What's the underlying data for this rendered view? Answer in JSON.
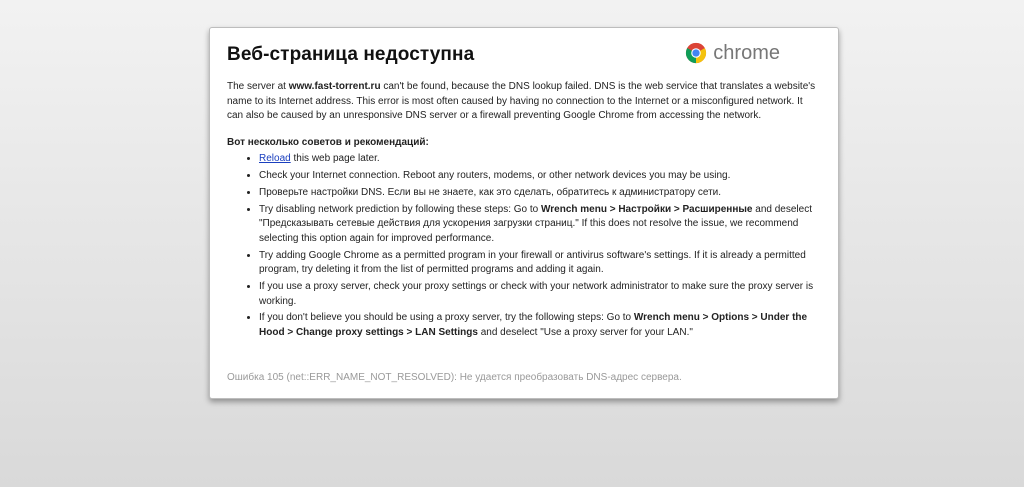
{
  "page": {
    "title": "Веб-страница недоступна",
    "brand": "chrome"
  },
  "intro": {
    "t1": "The server at ",
    "host": "www.fast-torrent.ru",
    "t2": " can't be found, because the DNS lookup failed. DNS is the web service that translates a website's name to its Internet address. This error is most often caused by having no connection to the Internet or a misconfigured network. It can also be caused by an unresponsive DNS server or a firewall preventing Google Chrome from accessing the network."
  },
  "tips": {
    "heading": "Вот несколько советов и рекомендаций:",
    "reload_link": "Reload",
    "reload_rest": " this web page later.",
    "check_connection": "Check your Internet connection. Reboot any routers, modems, or other network devices you may be using.",
    "dns_settings": "Проверьте настройки DNS. Если вы не знаете, как это сделать, обратитесь к администратору сети.",
    "prediction_a": "Try disabling network prediction by following these steps: Go to ",
    "prediction_path": "Wrench menu > Настройки > Расширенные",
    "prediction_b": " and deselect \"Предсказывать сетевые действия для ускорения загрузки страниц.\" If this does not resolve the issue, we recommend selecting this option again for improved performance.",
    "firewall": "Try adding Google Chrome as a permitted program in your firewall or antivirus software's settings. If it is already a permitted program, try deleting it from the list of permitted programs and adding it again.",
    "proxy_check": "If you use a proxy server, check your proxy settings or check with your network administrator to make sure the proxy server is working.",
    "proxy_a": "If you don't believe you should be using a proxy server, try the following steps: Go to ",
    "proxy_path": "Wrench menu > Options > Under the Hood > Change proxy settings > LAN Settings",
    "proxy_b": " and deselect \"Use a proxy server for your LAN.\""
  },
  "error": {
    "code": "Ошибка 105 (net::ERR_NAME_NOT_RESOLVED): Не удается преобразовать DNS-адрес сервера."
  },
  "colors": {
    "link": "#1a3fbf",
    "error_text": "#999999",
    "brand_text": "#777777"
  }
}
